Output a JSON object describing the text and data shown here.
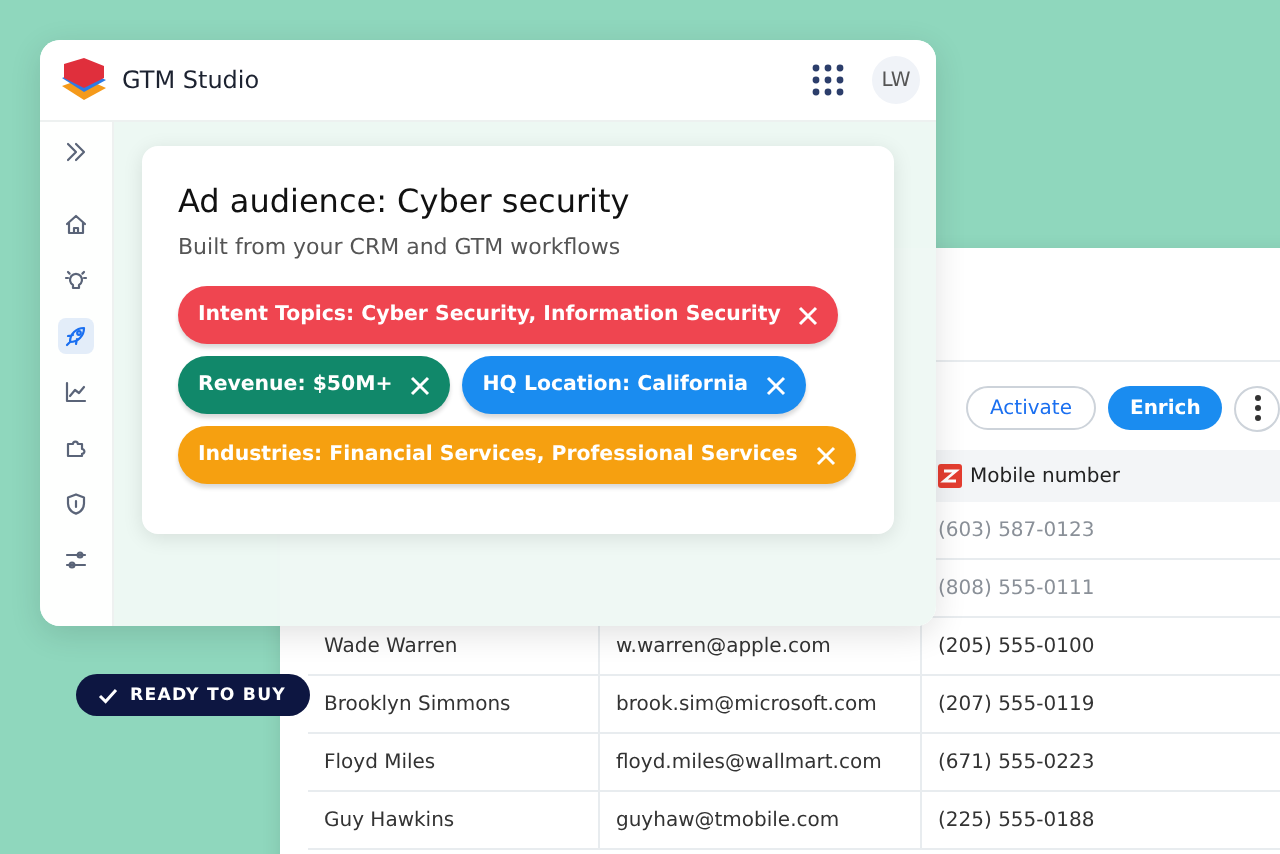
{
  "app_window": {
    "title": "GTM Studio",
    "avatar": "LW",
    "sidebar": [
      {
        "kind": "expand",
        "selected": false
      },
      {
        "kind": "home",
        "selected": false
      },
      {
        "kind": "idea",
        "selected": false
      },
      {
        "kind": "rocket",
        "selected": true
      },
      {
        "kind": "chart",
        "selected": false
      },
      {
        "kind": "puzzle",
        "selected": false
      },
      {
        "kind": "shield",
        "selected": false
      },
      {
        "kind": "sliders",
        "selected": false
      }
    ]
  },
  "audience_card": {
    "title": "Ad audience: Cyber security",
    "subtitle": "Built from your CRM and GTM workflows",
    "tags": [
      {
        "label": "Intent Topics: Cyber Security, Information Security",
        "color": "#ef4550"
      },
      {
        "label": "Revenue: $50M+",
        "color": "#11886a"
      },
      {
        "label": "HQ Location: California",
        "color": "#1a8cf0"
      },
      {
        "label": "Industries: Financial Services, Professional Services",
        "color": "#f6a010"
      }
    ]
  },
  "contacts_window": {
    "buttons": [
      "Activate",
      "Enrich"
    ],
    "columns": [
      "Mobile number"
    ],
    "rows": [
      {
        "phone": "(603) 587-0123",
        "faded": true
      },
      {
        "phone": "(808) 555-0111",
        "faded": true
      },
      {
        "name": "Wade Warren",
        "email": "w.warren@apple.com",
        "phone": "(205) 555-0100",
        "faded": false
      },
      {
        "name": "Brooklyn Simmons",
        "email": "brook.sim@microsoft.com",
        "phone": "(207) 555-0119",
        "faded": false
      },
      {
        "name": "Floyd Miles",
        "email": "floyd.miles@wallmart.com",
        "phone": "(671) 555-0223",
        "faded": false
      },
      {
        "name": "Guy Hawkins",
        "email": "guyhaw@tmobile.com",
        "phone": "(225) 555-0188",
        "faded": false
      }
    ]
  },
  "badge": "READY TO BUY"
}
